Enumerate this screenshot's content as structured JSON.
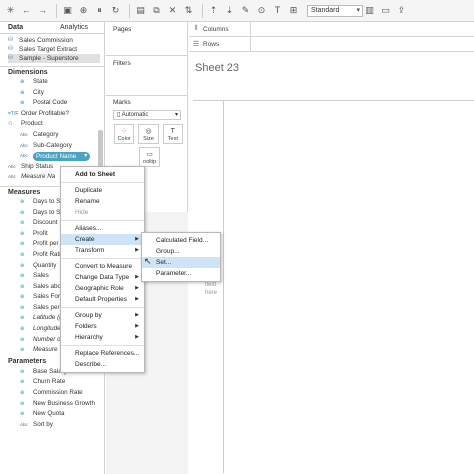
{
  "toolbar": {
    "icons": [
      "tableau-logo-icon",
      "undo-icon",
      "redo-icon",
      "save-icon",
      "add-datasource-icon",
      "pause-icon",
      "refresh-icon",
      "new-worksheet-icon",
      "duplicate-icon",
      "clear-icon",
      "swap-icon",
      "sort-asc-icon",
      "sort-desc-icon",
      "highlight-icon",
      "group-icon",
      "label-icon",
      "fix-axes-icon"
    ],
    "fit_select": "Standard"
  },
  "left": {
    "tabs": [
      "Data",
      "Analytics"
    ],
    "datasources": [
      {
        "label": "Sales Commission",
        "selected": false
      },
      {
        "label": "Sales Target Extract",
        "selected": false
      },
      {
        "label": "Sample - Superstore",
        "selected": true
      }
    ],
    "dimensions_title": "Dimensions",
    "dimensions": [
      {
        "label": "State",
        "icon": "globe",
        "indent": 2,
        "italic": false
      },
      {
        "label": "City",
        "icon": "globe",
        "indent": 2,
        "italic": false
      },
      {
        "label": "Postal Code",
        "icon": "globe",
        "indent": 2,
        "italic": false
      },
      {
        "label": "Order Profitable?",
        "icon": "calc",
        "indent": 1,
        "italic": false
      },
      {
        "label": "Product",
        "icon": "hierarchy",
        "indent": 1,
        "italic": false
      },
      {
        "label": "Category",
        "icon": "abc",
        "indent": 2,
        "italic": false
      },
      {
        "label": "Sub-Category",
        "icon": "abc",
        "indent": 2,
        "italic": false
      },
      {
        "label": "Product Name",
        "icon": "abc",
        "indent": 2,
        "italic": false,
        "pill": true
      },
      {
        "label": "Ship Status",
        "icon": "abc",
        "indent": 1,
        "italic": false
      },
      {
        "label": "Measure Na",
        "icon": "abc",
        "indent": 1,
        "italic": true
      }
    ],
    "measures_title": "Measures",
    "measures": [
      {
        "label": "Days to Ship",
        "italic": false
      },
      {
        "label": "Days to Ship",
        "italic": false
      },
      {
        "label": "Discount",
        "italic": false
      },
      {
        "label": "Profit",
        "italic": false
      },
      {
        "label": "Profit per",
        "italic": false
      },
      {
        "label": "Profit Ratio",
        "italic": false
      },
      {
        "label": "Quantity",
        "italic": false
      },
      {
        "label": "Sales",
        "italic": false
      },
      {
        "label": "Sales above",
        "italic": false
      },
      {
        "label": "Sales Foreca",
        "italic": false
      },
      {
        "label": "Sales per Cu",
        "italic": false
      },
      {
        "label": "Latitude (ge",
        "italic": true
      },
      {
        "label": "Longitude (g",
        "italic": true
      },
      {
        "label": "Number of R",
        "italic": true
      },
      {
        "label": "Measure Va",
        "italic": true
      }
    ],
    "parameters_title": "Parameters",
    "parameters": [
      {
        "label": "Base Salary",
        "icon": "num"
      },
      {
        "label": "Churn Rate",
        "icon": "num"
      },
      {
        "label": "Commission Rate",
        "icon": "num"
      },
      {
        "label": "New Business Growth",
        "icon": "num"
      },
      {
        "label": "New Quota",
        "icon": "num"
      },
      {
        "label": "Sort by",
        "icon": "abc"
      }
    ]
  },
  "mid": {
    "pages_label": "Pages",
    "filters_label": "Filters",
    "marks_label": "Marks",
    "marks_type": "Automatic",
    "mark_buttons": [
      {
        "label": "Color",
        "glyph": "⁘"
      },
      {
        "label": "Size",
        "glyph": "◎"
      },
      {
        "label": "Text",
        "glyph": "T"
      }
    ],
    "tooltip_label": "ooltip"
  },
  "right": {
    "columns_label": "Columns",
    "rows_label": "Rows",
    "sheet_title": "Sheet 23",
    "drop_hint": [
      "field",
      "here"
    ]
  },
  "context_menu": {
    "items": [
      {
        "label": "Add to Sheet",
        "bold": true
      },
      {
        "sep": true
      },
      {
        "label": "Duplicate"
      },
      {
        "label": "Rename"
      },
      {
        "label": "Hide",
        "disabled": true
      },
      {
        "sep": true
      },
      {
        "label": "Aliases..."
      },
      {
        "label": "Create",
        "submenu": true,
        "highlight": true
      },
      {
        "label": "Transform",
        "submenu": true
      },
      {
        "sep": true
      },
      {
        "label": "Convert to Measure"
      },
      {
        "label": "Change Data Type",
        "submenu": true
      },
      {
        "label": "Geographic Role",
        "submenu": true
      },
      {
        "label": "Default Properties",
        "submenu": true
      },
      {
        "sep": true
      },
      {
        "label": "Group by",
        "submenu": true
      },
      {
        "label": "Folders",
        "submenu": true
      },
      {
        "label": "Hierarchy",
        "submenu": true
      },
      {
        "sep": true
      },
      {
        "label": "Replace References..."
      },
      {
        "label": "Describe..."
      }
    ]
  },
  "create_submenu": {
    "items": [
      {
        "label": "Calculated Field..."
      },
      {
        "label": "Group..."
      },
      {
        "label": "Set...",
        "highlight": true
      },
      {
        "label": "Parameter..."
      }
    ]
  }
}
